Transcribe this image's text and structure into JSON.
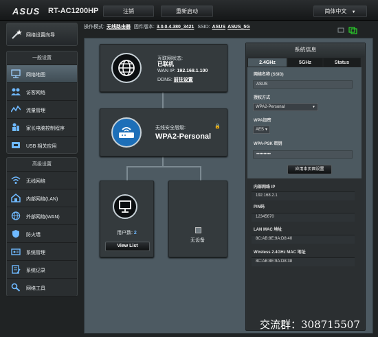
{
  "header": {
    "logo": "ASUS",
    "model": "RT-AC1200HP",
    "logout_label": "注销",
    "reboot_label": "重新启动",
    "language_label": "简体中文"
  },
  "status_bar": {
    "mode_label": "操作模式:",
    "mode_value": "无线路由器",
    "firmware_label": "固件版本:",
    "firmware_value": "3.0.0.4.380_3421",
    "ssid_label": "SSID:",
    "ssid_1": "ASUS",
    "ssid_2": "ASUS_5G"
  },
  "sidebar": {
    "quick_setup": "网络设置向导",
    "general_header": "一般设置",
    "general_items": [
      {
        "label": "网络地图",
        "icon": "network-map-icon"
      },
      {
        "label": "访客网络",
        "icon": "guest-network-icon"
      },
      {
        "label": "流量管理",
        "icon": "traffic-manager-icon"
      },
      {
        "label": "家长电脑控制程序",
        "icon": "parental-control-icon"
      },
      {
        "label": "USB 相关应用",
        "icon": "usb-icon"
      }
    ],
    "advanced_header": "高级设置",
    "advanced_items": [
      {
        "label": "无线网络",
        "icon": "wireless-icon"
      },
      {
        "label": "内部网络(LAN)",
        "icon": "lan-icon"
      },
      {
        "label": "外部网络(WAN)",
        "icon": "wan-icon"
      },
      {
        "label": "防火墙",
        "icon": "firewall-icon"
      },
      {
        "label": "系统管理",
        "icon": "administration-icon"
      },
      {
        "label": "系统记录",
        "icon": "system-log-icon"
      },
      {
        "label": "网络工具",
        "icon": "network-tools-icon"
      }
    ]
  },
  "map": {
    "internet_status_label": "互联网状态:",
    "internet_status_value": "已联机",
    "wan_ip_label": "WAN IP:",
    "wan_ip_value": "192.168.1.100",
    "ddns_label": "DDNS:",
    "ddns_value": "前往设置",
    "security_label": "无线安全层级:",
    "security_value": "WPA2-Personal",
    "clients_label": "用户数:",
    "clients_count": "2",
    "view_list_label": "View List",
    "no_device_label": "无设备"
  },
  "system_status": {
    "title": "系统信息",
    "tabs": [
      "2.4GHz",
      "5GHz",
      "Status"
    ],
    "active_tab": 0,
    "ssid_label": "网络名称 (SSID)",
    "ssid_value": "ASUS",
    "auth_label": "授权方式",
    "auth_value": "WPA2-Personal",
    "encryption_label": "WPA加密",
    "encryption_value": "AES",
    "psk_label": "WPA-PSK 密钥",
    "psk_value": "••••••••••",
    "apply_label": "应用本页面设置",
    "lan_ip_label": "内部网络 IP",
    "lan_ip_value": "192.168.2.1",
    "pin_label": "PIN码",
    "pin_value": "12345670",
    "lan_mac_label": "LAN MAC 地址",
    "lan_mac_value": "8C:AB:8E:9A:D8:40",
    "wl_mac_label": "Wireless 2.4GHz MAC 地址",
    "wl_mac_value": "8C:AB:8E:9A:D8:38"
  },
  "watermark": "交流群：308715507",
  "colors": {
    "background": "#202324",
    "main_panel": "#4d5a62",
    "card": "#343a3d",
    "accent_blue": "#1d6fb8",
    "active_nav": "#4a5a64"
  }
}
